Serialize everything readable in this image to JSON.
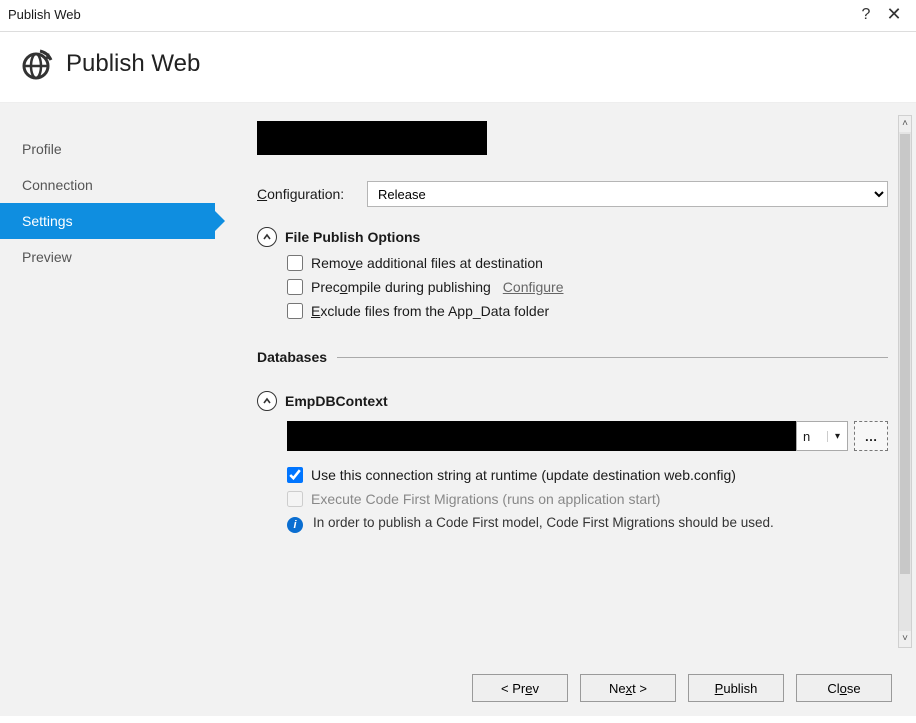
{
  "window": {
    "title": "Publish Web"
  },
  "header": {
    "title": "Publish Web"
  },
  "nav": {
    "items": [
      {
        "label": "Profile"
      },
      {
        "label": "Connection"
      },
      {
        "label": "Settings",
        "active": true
      },
      {
        "label": "Preview"
      }
    ]
  },
  "config": {
    "label": "Configuration:",
    "value": "Release"
  },
  "filePublish": {
    "title": "File Publish Options",
    "opts": {
      "remove": "Remove additional files at destination",
      "precompile": "Precompile during publishing",
      "configureLink": "Configure",
      "exclude": "Exclude files from the App_Data folder"
    }
  },
  "databases": {
    "title": "Databases",
    "context": "EmpDBContext",
    "connTail": "n",
    "useConn": "Use this connection string at runtime (update destination web.config)",
    "execMigrations": "Execute Code First Migrations (runs on application start)",
    "info": "In order to publish a Code First model, Code First Migrations should be used."
  },
  "buttons": {
    "prev": "< Prev",
    "next": "Next >",
    "publish": "Publish",
    "close": "Close"
  }
}
